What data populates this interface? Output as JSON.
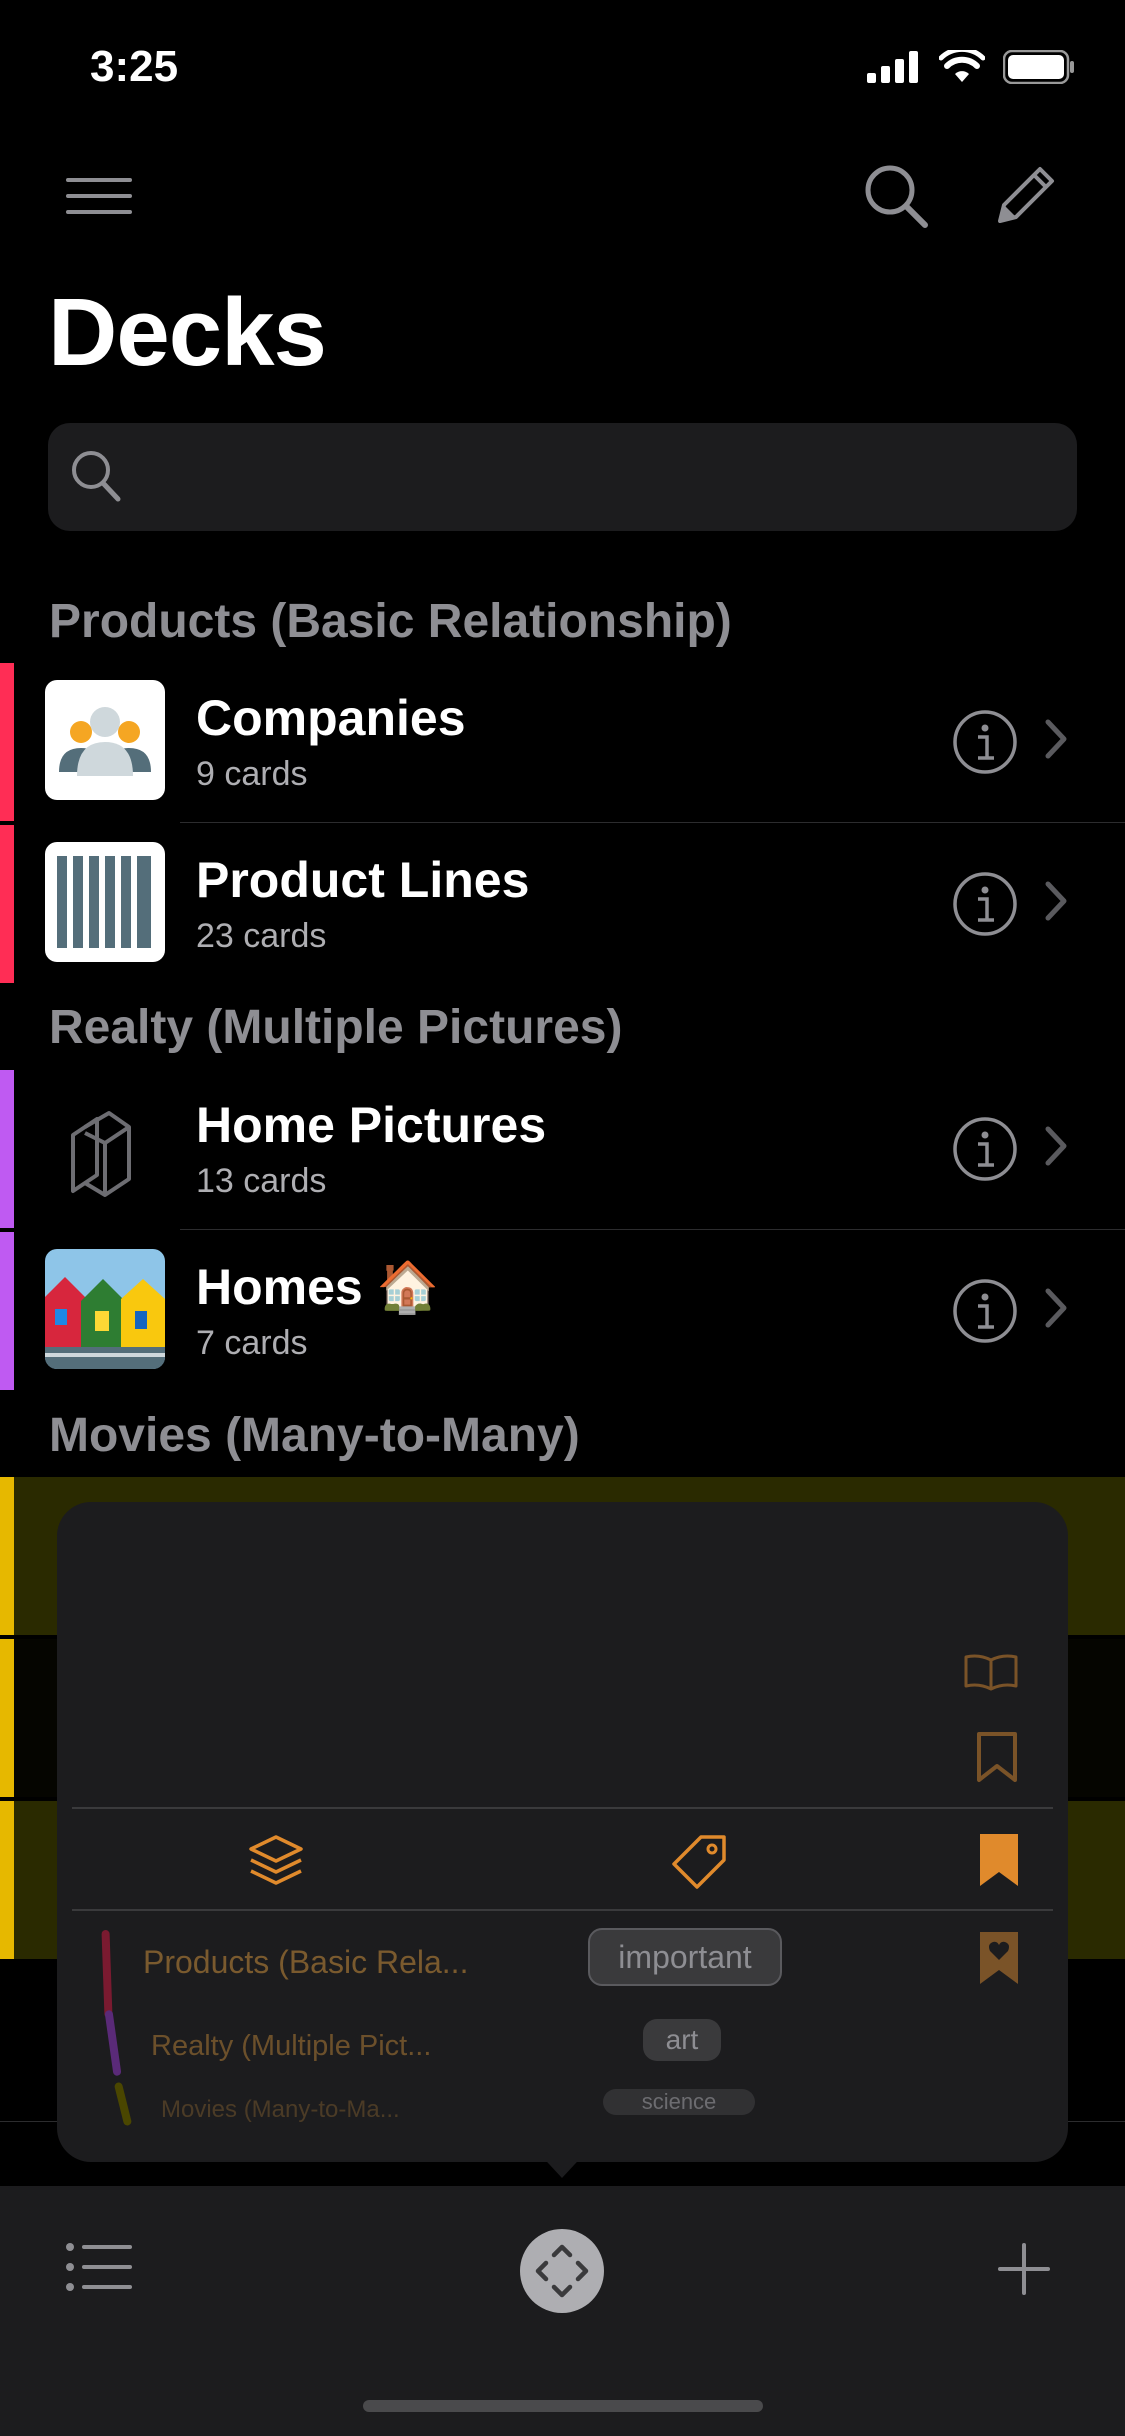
{
  "status": {
    "time": "3:25"
  },
  "header": {
    "title": "Decks",
    "search_placeholder": ""
  },
  "sections": [
    {
      "title": "Products (Basic Relationship)",
      "color": "#ff2d55",
      "items": [
        {
          "title": "Companies",
          "subtitle": "9 cards"
        },
        {
          "title": "Product Lines",
          "subtitle": "23 cards"
        }
      ]
    },
    {
      "title": "Realty (Multiple Pictures)",
      "color": "#bf5af2",
      "items": [
        {
          "title": "Home Pictures",
          "subtitle": "13 cards"
        },
        {
          "title": "Homes 🏠",
          "subtitle": "7 cards"
        }
      ]
    },
    {
      "title": "Movies (Many-to-Many)",
      "color": "#e6b800",
      "items": []
    }
  ],
  "popover": {
    "accent": "#e08a2c",
    "deck_list": [
      "Products (Basic Rela...",
      "Realty (Multiple Pict...",
      "Movies (Many-to-Ma..."
    ],
    "tags": [
      "important",
      "art",
      "science"
    ],
    "icons": [
      "book-open-icon",
      "bookmark-outline-icon",
      "stack-icon",
      "tag-icon",
      "bookmark-filled-icon",
      "bookmark-heart-icon"
    ]
  },
  "toolbar": {
    "icons": [
      "list-icon",
      "navigator-icon",
      "plus-icon"
    ]
  }
}
